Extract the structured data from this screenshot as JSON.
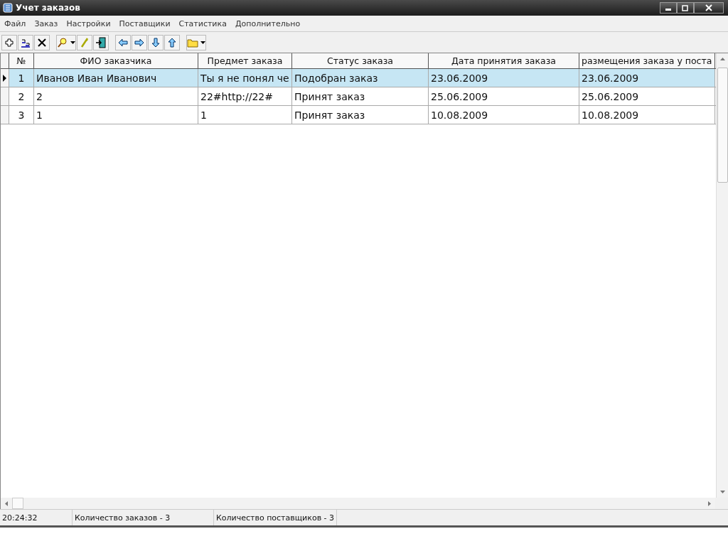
{
  "window": {
    "title": "Учет заказов"
  },
  "menu": [
    "Файл",
    "Заказ",
    "Настройки",
    "Поставщики",
    "Статистика",
    "Дополнительно"
  ],
  "table": {
    "columns": [
      "№",
      "ФИО заказчика",
      "Предмет заказа",
      "Статус заказа",
      "Дата принятия заказа",
      "размещения заказа у поста"
    ],
    "rows": [
      {
        "selected": true,
        "cells": [
          "1",
          "Иванов Иван Иванович",
          "Ты я не понял че",
          "Подобран заказ",
          "23.06.2009",
          "23.06.2009"
        ]
      },
      {
        "selected": false,
        "cells": [
          "2",
          "2",
          "22#http://22#",
          "Принят заказ",
          "25.06.2009",
          "25.06.2009"
        ]
      },
      {
        "selected": false,
        "cells": [
          "3",
          "1",
          "1",
          "Принят заказ",
          "10.08.2009",
          "10.08.2009"
        ]
      }
    ]
  },
  "status_bar": [
    "20:24:32",
    "Количество заказов - 3",
    "Количество поставщиков - 3"
  ]
}
